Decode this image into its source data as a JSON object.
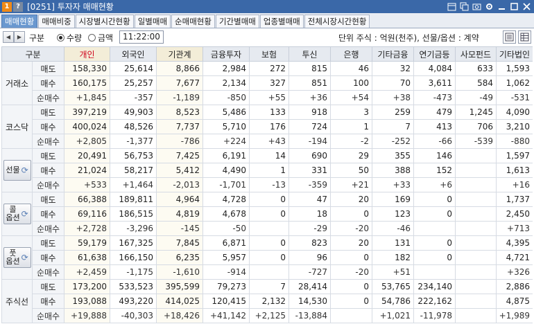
{
  "window": {
    "badge1": "1",
    "badge2": "?",
    "title": "[0251] 투자자 매매현황",
    "icons": [
      "calendar-icon",
      "copy-icon",
      "capture-icon",
      "settings-icon",
      "minimize-icon",
      "maximize-icon",
      "close-icon"
    ]
  },
  "tabs": [
    {
      "label": "매매현황",
      "active": true
    },
    {
      "label": "매매비중",
      "active": false
    },
    {
      "label": "시장별시간현황",
      "active": false
    },
    {
      "label": "일별매매",
      "active": false
    },
    {
      "label": "순매매현황",
      "active": false
    },
    {
      "label": "기간별매매",
      "active": false
    },
    {
      "label": "업종별매매",
      "active": false
    },
    {
      "label": "전체시장시간현황",
      "active": false
    }
  ],
  "toolbar": {
    "prev_glyph": "◀",
    "next_glyph": "▶",
    "group_label": "구분",
    "radio_qty": "수량",
    "radio_amt": "금액",
    "selected": "qty",
    "time": "11:22:00",
    "unit_text": "단위 주식 : 억원(천주), 선물/옵션 : 계약"
  },
  "table": {
    "headers": [
      "구분",
      "",
      "개인",
      "외국인",
      "기관계",
      "금융투자",
      "보험",
      "투신",
      "은행",
      "기타금융",
      "연기금등",
      "사모펀드",
      "기타법인"
    ],
    "sub_labels": [
      "매도",
      "매수",
      "순매수"
    ],
    "groups": [
      {
        "name": "거래소",
        "button": false,
        "rows": [
          [
            "158,330",
            "25,614",
            "8,866",
            "2,984",
            "272",
            "815",
            "46",
            "32",
            "4,084",
            "633",
            "1,593"
          ],
          [
            "160,175",
            "25,257",
            "7,677",
            "2,134",
            "327",
            "851",
            "100",
            "70",
            "3,611",
            "584",
            "1,062"
          ],
          [
            "+1,845",
            "-357",
            "-1,189",
            "-850",
            "+55",
            "+36",
            "+54",
            "+38",
            "-473",
            "-49",
            "-531"
          ]
        ]
      },
      {
        "name": "코스닥",
        "button": false,
        "rows": [
          [
            "397,219",
            "49,903",
            "8,523",
            "5,486",
            "133",
            "918",
            "3",
            "259",
            "479",
            "1,245",
            "4,090"
          ],
          [
            "400,024",
            "48,526",
            "7,737",
            "5,710",
            "176",
            "724",
            "1",
            "7",
            "413",
            "706",
            "3,210"
          ],
          [
            "+2,805",
            "-1,377",
            "-786",
            "+224",
            "+43",
            "-194",
            "-2",
            "-252",
            "-66",
            "-539",
            "-880"
          ]
        ]
      },
      {
        "name": "선물",
        "button": true,
        "rows": [
          [
            "20,491",
            "56,753",
            "7,425",
            "6,191",
            "14",
            "690",
            "29",
            "355",
            "146",
            "",
            "1,597"
          ],
          [
            "21,024",
            "58,217",
            "5,412",
            "4,490",
            "1",
            "331",
            "50",
            "388",
            "152",
            "",
            "1,613"
          ],
          [
            "+533",
            "+1,464",
            "-2,013",
            "-1,701",
            "-13",
            "-359",
            "+21",
            "+33",
            "+6",
            "",
            "+16"
          ]
        ]
      },
      {
        "name": "콜\n옵션",
        "button": true,
        "rows": [
          [
            "66,388",
            "189,811",
            "4,964",
            "4,728",
            "0",
            "47",
            "20",
            "169",
            "0",
            "",
            "1,737"
          ],
          [
            "69,116",
            "186,515",
            "4,819",
            "4,678",
            "0",
            "18",
            "0",
            "123",
            "0",
            "",
            "2,450"
          ],
          [
            "+2,728",
            "-3,296",
            "-145",
            "-50",
            "",
            "-29",
            "-20",
            "-46",
            "",
            "",
            "+713"
          ]
        ]
      },
      {
        "name": "풋\n옵션",
        "button": true,
        "rows": [
          [
            "59,179",
            "167,325",
            "7,845",
            "6,871",
            "0",
            "823",
            "20",
            "131",
            "0",
            "",
            "4,395"
          ],
          [
            "61,638",
            "166,150",
            "6,235",
            "5,957",
            "0",
            "96",
            "0",
            "182",
            "0",
            "",
            "4,721"
          ],
          [
            "+2,459",
            "-1,175",
            "-1,610",
            "-914",
            "",
            "-727",
            "-20",
            "+51",
            "",
            "",
            "+326"
          ]
        ]
      },
      {
        "name": "주식선",
        "button": false,
        "rows": [
          [
            "173,200",
            "533,523",
            "395,599",
            "79,273",
            "7",
            "28,414",
            "0",
            "53,765",
            "234,140",
            "",
            "2,886"
          ],
          [
            "193,088",
            "493,220",
            "414,025",
            "120,415",
            "2,132",
            "14,530",
            "0",
            "54,786",
            "222,162",
            "",
            "4,875"
          ],
          [
            "+19,888",
            "-40,303",
            "+18,426",
            "+41,142",
            "+2,125",
            "-13,884",
            "",
            "+1,021",
            "-11,978",
            "",
            "+1,989"
          ]
        ]
      }
    ]
  }
}
